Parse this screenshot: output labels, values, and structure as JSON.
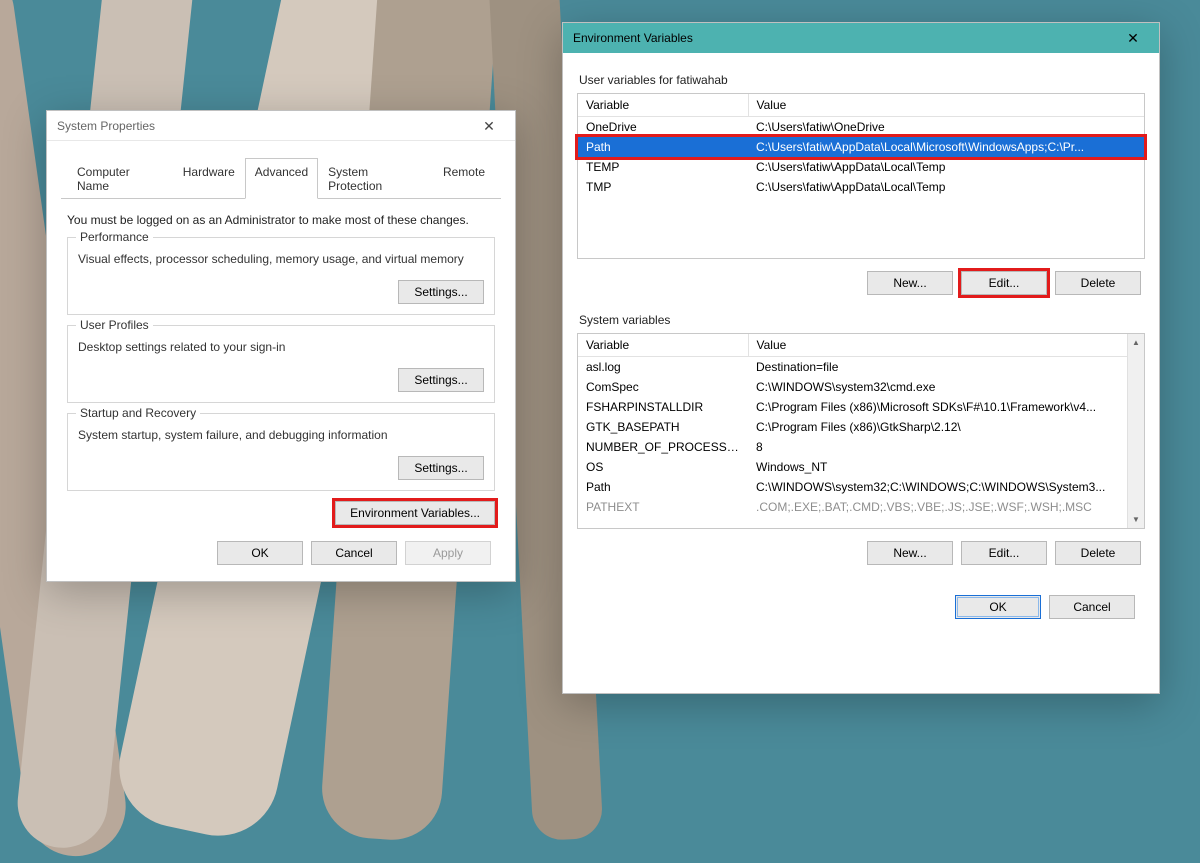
{
  "sysprop": {
    "title": "System Properties",
    "tabs": [
      "Computer Name",
      "Hardware",
      "Advanced",
      "System Protection",
      "Remote"
    ],
    "active_tab": 2,
    "instruction": "You must be logged on as an Administrator to make most of these changes.",
    "groups": {
      "performance": {
        "label": "Performance",
        "text": "Visual effects, processor scheduling, memory usage, and virtual memory",
        "button": "Settings..."
      },
      "profiles": {
        "label": "User Profiles",
        "text": "Desktop settings related to your sign-in",
        "button": "Settings..."
      },
      "startup": {
        "label": "Startup and Recovery",
        "text": "System startup, system failure, and debugging information",
        "button": "Settings..."
      }
    },
    "env_button": "Environment Variables...",
    "ok": "OK",
    "cancel": "Cancel",
    "apply": "Apply"
  },
  "env": {
    "title": "Environment Variables",
    "user_section": "User variables for fatiwahab",
    "sys_section": "System variables",
    "col_var": "Variable",
    "col_val": "Value",
    "user_rows": [
      {
        "var": "OneDrive",
        "val": "C:\\Users\\fatiw\\OneDrive"
      },
      {
        "var": "Path",
        "val": "C:\\Users\\fatiw\\AppData\\Local\\Microsoft\\WindowsApps;C:\\Pr..."
      },
      {
        "var": "TEMP",
        "val": "C:\\Users\\fatiw\\AppData\\Local\\Temp"
      },
      {
        "var": "TMP",
        "val": "C:\\Users\\fatiw\\AppData\\Local\\Temp"
      }
    ],
    "sys_rows": [
      {
        "var": "asl.log",
        "val": "Destination=file"
      },
      {
        "var": "ComSpec",
        "val": "C:\\WINDOWS\\system32\\cmd.exe"
      },
      {
        "var": "FSHARPINSTALLDIR",
        "val": "C:\\Program Files (x86)\\Microsoft SDKs\\F#\\10.1\\Framework\\v4..."
      },
      {
        "var": "GTK_BASEPATH",
        "val": "C:\\Program Files (x86)\\GtkSharp\\2.12\\"
      },
      {
        "var": "NUMBER_OF_PROCESSORS",
        "val": "8"
      },
      {
        "var": "OS",
        "val": "Windows_NT"
      },
      {
        "var": "Path",
        "val": "C:\\WINDOWS\\system32;C:\\WINDOWS;C:\\WINDOWS\\System3..."
      },
      {
        "var": "PATHEXT",
        "val": ".COM;.EXE;.BAT;.CMD;.VBS;.VBE;.JS;.JSE;.WSF;.WSH;.MSC"
      }
    ],
    "new": "New...",
    "edit": "Edit...",
    "delete": "Delete",
    "ok": "OK",
    "cancel": "Cancel"
  }
}
